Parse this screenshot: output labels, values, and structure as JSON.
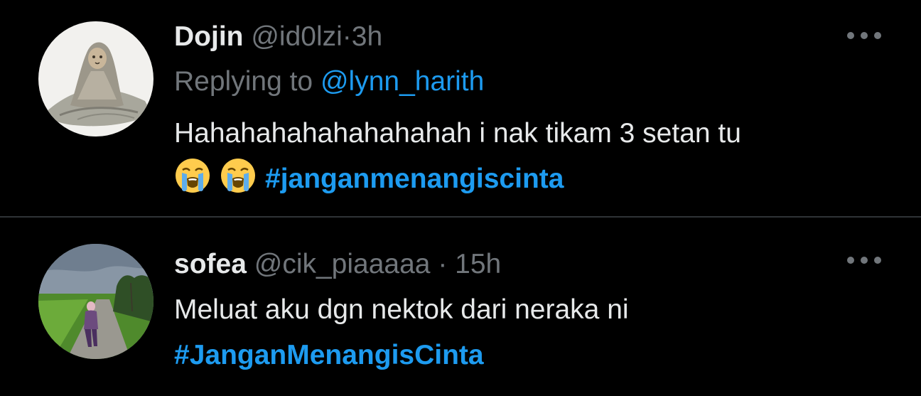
{
  "tweets": [
    {
      "name": "Dojin",
      "handle": "@id0lzi",
      "separator": "·",
      "time": "3h",
      "replying_prefix": "Replying to ",
      "replying_to": "@lynn_harith",
      "text": "Hahahahahahahahahah i nak tikam 3 setan tu",
      "emojis": [
        "😭",
        "😭"
      ],
      "hashtag": "#janganmenangiscinta",
      "avatar_icon": "cat-in-blanket-avatar",
      "more_icon": "more-options-icon"
    },
    {
      "name": "sofea",
      "handle": "@cik_piaaaaa",
      "separator": "·",
      "time": "15h",
      "text": "Meluat aku dgn nektok dari neraka ni",
      "hashtag": "#JanganMenangisCinta",
      "avatar_icon": "person-on-road-avatar",
      "more_icon": "more-options-icon"
    }
  ],
  "colors": {
    "background": "#000000",
    "primary_text": "#e7e9ea",
    "secondary_text": "#71767b",
    "accent": "#1d9bf0",
    "divider": "#2f3336"
  }
}
